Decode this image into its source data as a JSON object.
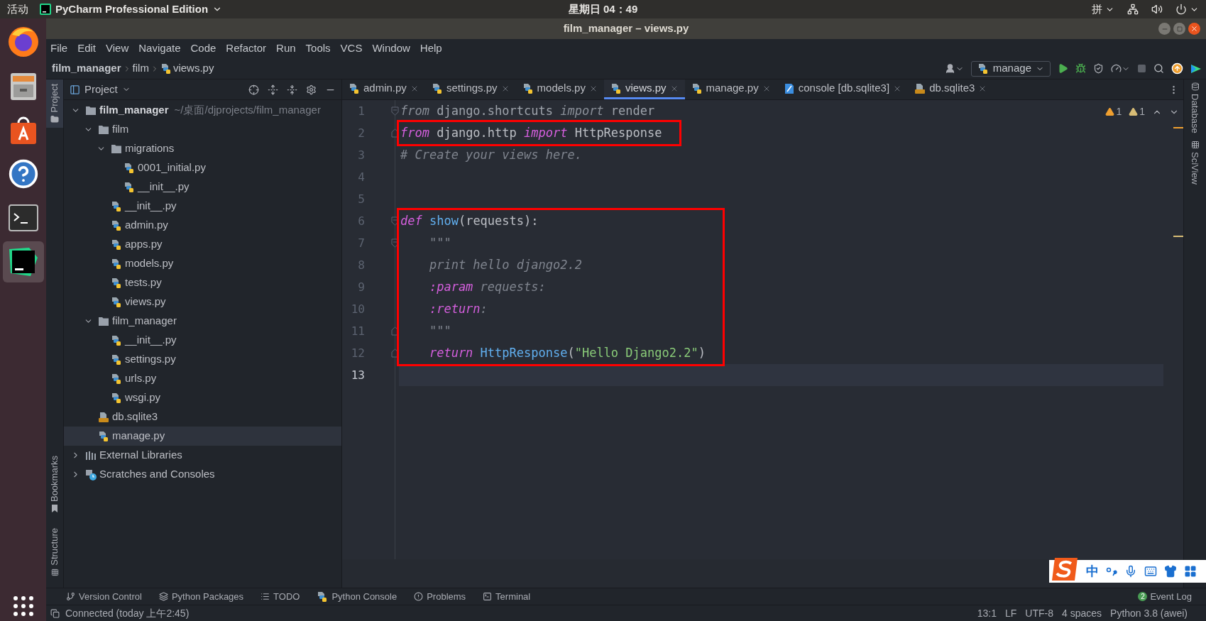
{
  "system_bar": {
    "activities": "活动",
    "app_name": "PyCharm Professional Edition",
    "clock": "星期日 04：49",
    "input_method": "拼"
  },
  "window": {
    "title": "film_manager – views.py"
  },
  "menu": [
    "File",
    "Edit",
    "View",
    "Navigate",
    "Code",
    "Refactor",
    "Run",
    "Tools",
    "VCS",
    "Window",
    "Help"
  ],
  "breadcrumb": [
    {
      "label": "film_manager",
      "kind": "project"
    },
    {
      "label": "film",
      "kind": "folder"
    },
    {
      "label": "views.py",
      "kind": "python"
    }
  ],
  "run_config": "manage",
  "left_stripe": {
    "top": [
      {
        "label": "Project",
        "selected": true
      }
    ],
    "bottom": [
      {
        "label": "Bookmarks",
        "selected": false
      },
      {
        "label": "Structure",
        "selected": false
      }
    ]
  },
  "project_panel": {
    "title": "Project",
    "tree": [
      {
        "label": "film_manager",
        "kind": "project",
        "path": "~/桌面/djprojects/film_manager",
        "expanded": true,
        "selected": false,
        "children": [
          {
            "label": "film",
            "kind": "folder",
            "expanded": true,
            "selected": false,
            "children": [
              {
                "label": "migrations",
                "kind": "folder",
                "expanded": true,
                "selected": false,
                "children": [
                  {
                    "label": "0001_initial.py",
                    "kind": "python",
                    "selected": false
                  },
                  {
                    "label": "__init__.py",
                    "kind": "python",
                    "selected": false
                  }
                ]
              },
              {
                "label": "__init__.py",
                "kind": "python",
                "selected": false
              },
              {
                "label": "admin.py",
                "kind": "python",
                "selected": false
              },
              {
                "label": "apps.py",
                "kind": "python",
                "selected": false
              },
              {
                "label": "models.py",
                "kind": "python",
                "selected": false
              },
              {
                "label": "tests.py",
                "kind": "python",
                "selected": false
              },
              {
                "label": "views.py",
                "kind": "python",
                "selected": false
              }
            ]
          },
          {
            "label": "film_manager",
            "kind": "folder",
            "expanded": true,
            "selected": false,
            "children": [
              {
                "label": "__init__.py",
                "kind": "python",
                "selected": false
              },
              {
                "label": "settings.py",
                "kind": "python",
                "selected": false
              },
              {
                "label": "urls.py",
                "kind": "python",
                "selected": false
              },
              {
                "label": "wsgi.py",
                "kind": "python",
                "selected": false
              }
            ]
          },
          {
            "label": "db.sqlite3",
            "kind": "sqlite",
            "selected": false
          },
          {
            "label": "manage.py",
            "kind": "python",
            "selected": true
          }
        ]
      },
      {
        "label": "External Libraries",
        "kind": "libraries",
        "expanded": false,
        "selected": false
      },
      {
        "label": "Scratches and Consoles",
        "kind": "scratches",
        "expanded": false,
        "selected": false
      }
    ]
  },
  "editor_tabs": [
    {
      "label": "admin.py",
      "kind": "python",
      "selected": false
    },
    {
      "label": "settings.py",
      "kind": "python",
      "selected": false
    },
    {
      "label": "models.py",
      "kind": "python",
      "selected": false
    },
    {
      "label": "views.py",
      "kind": "python",
      "selected": true
    },
    {
      "label": "manage.py",
      "kind": "python",
      "selected": false
    },
    {
      "label": "console [db.sqlite3]",
      "kind": "console",
      "selected": false
    },
    {
      "label": "db.sqlite3",
      "kind": "sqlite",
      "selected": false
    }
  ],
  "inspections": [
    {
      "kind": "warning",
      "count": "1"
    },
    {
      "kind": "weak_warning",
      "count": "1"
    }
  ],
  "editor": {
    "blocks": [
      {
        "boxed": false,
        "lines": [
          {
            "number": "1",
            "fold_open": true,
            "current": false,
            "tokens": [
              {
                "text": "from",
                "kind": "unused_keyword"
              },
              {
                "text": " django.shortcuts ",
                "kind": "unused"
              },
              {
                "text": "import",
                "kind": "unused_keyword"
              },
              {
                "text": " render",
                "kind": "unused"
              }
            ]
          }
        ]
      },
      {
        "boxed": true,
        "lines": [
          {
            "number": "2",
            "fold_close": true,
            "current": false,
            "tokens": [
              {
                "text": "from",
                "kind": "keyword"
              },
              {
                "text": " django.http ",
                "kind": "plain"
              },
              {
                "text": "import",
                "kind": "keyword"
              },
              {
                "text": " HttpResponse",
                "kind": "plain"
              }
            ]
          }
        ]
      },
      {
        "boxed": false,
        "lines": [
          {
            "number": "3",
            "current": false,
            "tokens": [
              {
                "text": "# Create your views here.",
                "kind": "comment"
              }
            ]
          },
          {
            "number": "4",
            "current": false
          },
          {
            "number": "5",
            "current": false
          }
        ]
      },
      {
        "boxed": true,
        "lines": [
          {
            "number": "6",
            "fold_open": true,
            "current": false,
            "tokens": [
              {
                "text": "def ",
                "kind": "keyword"
              },
              {
                "text": "show",
                "kind": "function"
              },
              {
                "text": "(requests):",
                "kind": "plain"
              }
            ]
          },
          {
            "number": "7",
            "fold_open": true,
            "current": false,
            "tokens": [
              {
                "text": "    \"\"\"",
                "kind": "docstring"
              }
            ]
          },
          {
            "number": "8",
            "current": false,
            "tokens": [
              {
                "text": "    print hello django2.2",
                "kind": "docstring"
              }
            ]
          },
          {
            "number": "9",
            "current": false,
            "tokens": [
              {
                "text": "    :param",
                "kind": "doc_tag"
              },
              {
                "text": " requests:",
                "kind": "docstring"
              }
            ]
          },
          {
            "number": "10",
            "current": false,
            "tokens": [
              {
                "text": "    :return",
                "kind": "doc_tag"
              },
              {
                "text": ":",
                "kind": "docstring"
              }
            ]
          },
          {
            "number": "11",
            "fold_close": true,
            "current": false,
            "tokens": [
              {
                "text": "    \"\"\"",
                "kind": "docstring"
              }
            ]
          },
          {
            "number": "12",
            "fold_close": true,
            "current": false,
            "tokens": [
              {
                "text": "    return ",
                "kind": "keyword"
              },
              {
                "text": "HttpResponse",
                "kind": "function"
              },
              {
                "text": "(",
                "kind": "plain"
              },
              {
                "text": "\"Hello Django2.2\"",
                "kind": "string"
              },
              {
                "text": ")",
                "kind": "plain"
              }
            ]
          }
        ]
      },
      {
        "boxed": false,
        "lines": [
          {
            "number": "13",
            "current": true
          }
        ]
      }
    ]
  },
  "right_stripe": [
    {
      "label": "Database",
      "kind": "database"
    },
    {
      "label": "SciView",
      "kind": "grid"
    }
  ],
  "tool_windows": [
    {
      "label": "Version Control",
      "kind": "vcs"
    },
    {
      "label": "Python Packages",
      "kind": "packages"
    },
    {
      "label": "TODO",
      "kind": "todo"
    },
    {
      "label": "Python Console",
      "kind": "python"
    },
    {
      "label": "Problems",
      "kind": "problems"
    },
    {
      "label": "Terminal",
      "kind": "terminal"
    }
  ],
  "event_log": {
    "label": "Event Log",
    "badge": "2"
  },
  "status_bar": {
    "message": "Connected (today 上午2:45)",
    "items": [
      "13:1",
      "LF",
      "UTF-8",
      "4 spaces",
      "Python 3.8 (awei)"
    ]
  },
  "ime_bar": {
    "label": "中"
  }
}
